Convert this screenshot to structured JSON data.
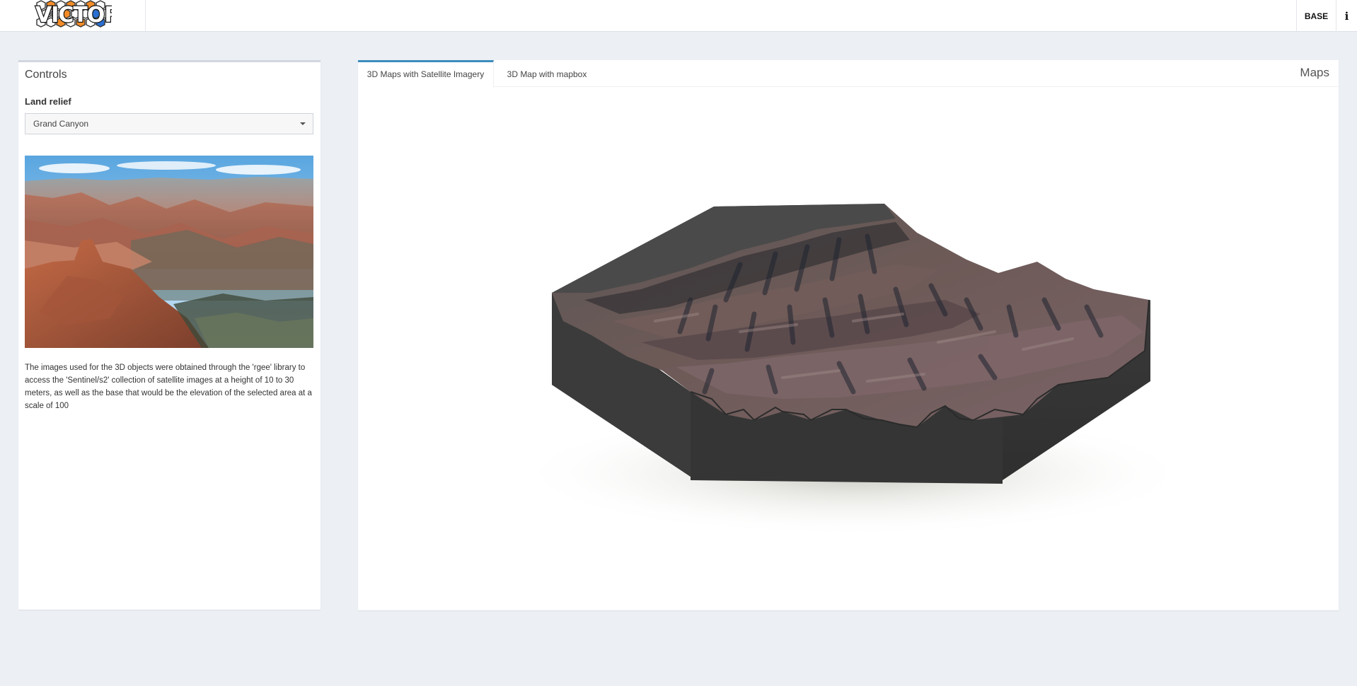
{
  "app": {
    "logo_text": "VICTOR",
    "base_label": "BASE",
    "info_label": "i"
  },
  "controls": {
    "title": "Controls",
    "land_relief_label": "Land relief",
    "land_relief_value": "Grand Canyon",
    "description": "The images used for the 3D objects were obtained through the 'rgee' library to access the 'Sentinel/s2' collection of satellite images at a height of 10 to 30 meters, as well as the base that would be the elevation of the selected area at a scale of 100"
  },
  "maps": {
    "title": "Maps",
    "tabs": [
      {
        "label": "3D Maps with Satellite Imagery",
        "active": true
      },
      {
        "label": "3D Map with mapbox",
        "active": false
      }
    ]
  },
  "colors": {
    "accent": "#3c8dbc",
    "background": "#ecf0f5",
    "logo_orange": "#f28c28",
    "logo_blue": "#2a6fd1"
  }
}
